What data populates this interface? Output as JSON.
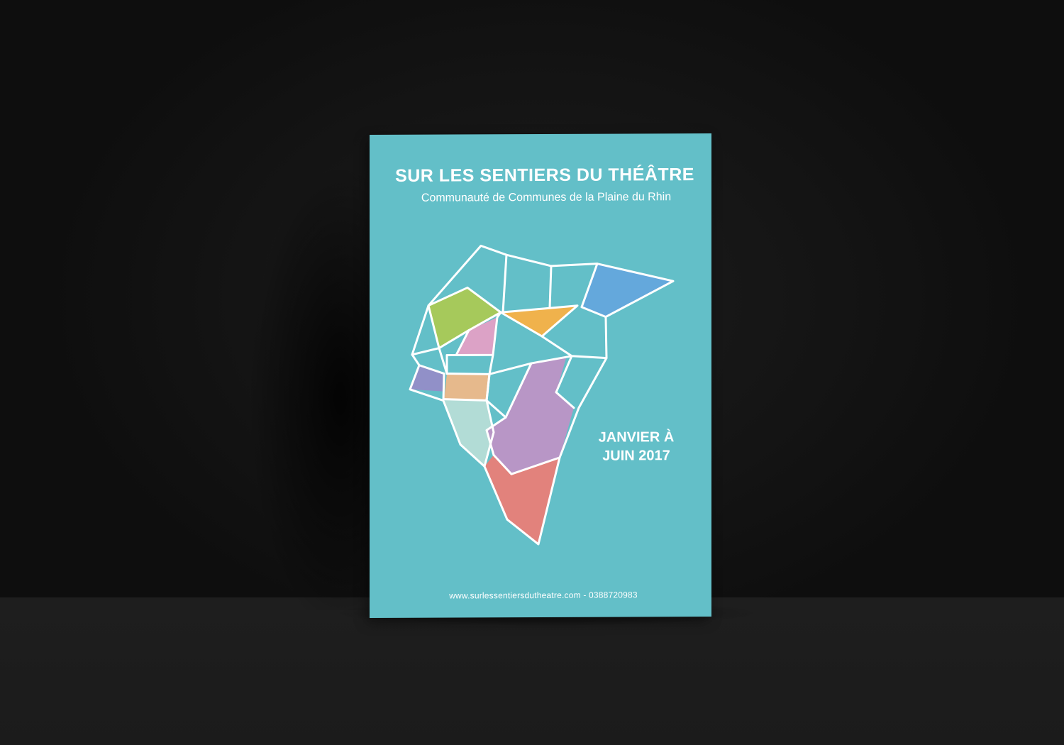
{
  "poster": {
    "title": "SUR LES SENTIERS DU THÉÂTRE",
    "subtitle": "Communauté de Communes de la Plaine du Rhin",
    "dates_line1": "JANVIER À",
    "dates_line2": "JUIN 2017",
    "footer": "www.surlessentiersdutheatre.com - 0388720983"
  },
  "colors": {
    "background": "#121212",
    "poster": "#63bfc8",
    "outline": "#ffffff",
    "green": "#a6c95b",
    "orange": "#f0b24c",
    "blue": "#64a8dc",
    "pink": "#dca2c6",
    "indigo": "#9190c8",
    "peach": "#e6b98c",
    "mint": "#b2dcd6",
    "lavender": "#b896c6",
    "salmon": "#e2827c"
  }
}
